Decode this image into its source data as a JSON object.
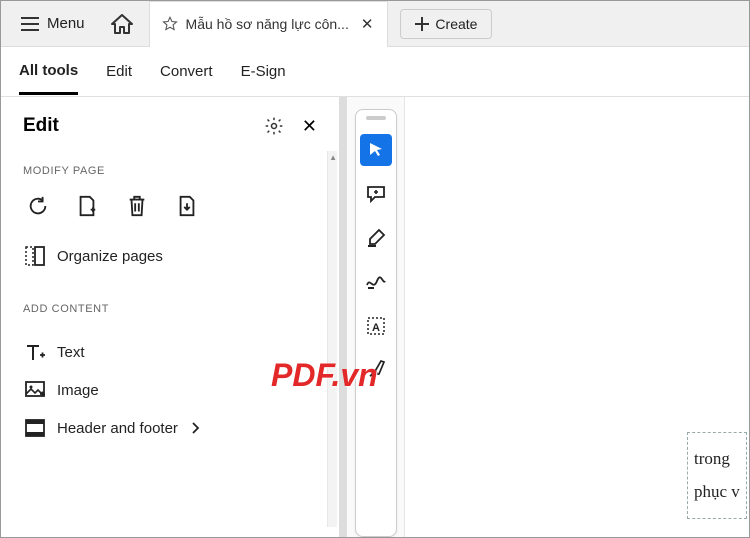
{
  "titlebar": {
    "menu_label": "Menu",
    "tab_title": "Mẫu hồ sơ năng lực côn...",
    "create_label": "Create"
  },
  "toolbar": {
    "tabs": [
      "All tools",
      "Edit",
      "Convert",
      "E-Sign"
    ],
    "active_index": 0
  },
  "side": {
    "title": "Edit",
    "section_modify": "MODIFY PAGE",
    "organize_pages": "Organize pages",
    "section_add": "ADD CONTENT",
    "text": "Text",
    "image": "Image",
    "header_footer": "Header and footer"
  },
  "watermark": "PDF.vn",
  "doc_text": {
    "line1": "trong",
    "line2": "phục v"
  }
}
